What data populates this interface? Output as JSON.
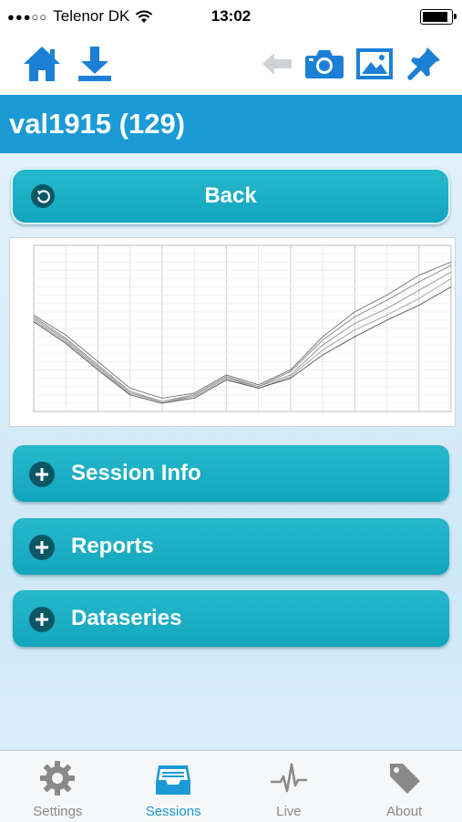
{
  "status_bar": {
    "carrier": "Telenor DK",
    "time": "13:02"
  },
  "toolbar": {
    "icons": [
      "home-icon",
      "download-icon",
      "back-arrow-icon",
      "camera-icon",
      "image-icon",
      "pin-icon"
    ]
  },
  "header": {
    "title": "val1915 (129)"
  },
  "back_button": {
    "label": "Back"
  },
  "sections": [
    {
      "label": "Session Info"
    },
    {
      "label": "Reports"
    },
    {
      "label": "Dataseries"
    }
  ],
  "colors": {
    "accent": "#1b9ad6",
    "pill": "#17aac0",
    "tab_active": "#1b9ad6",
    "tab_inactive": "#8a8a8a"
  },
  "tabs": [
    {
      "label": "Settings",
      "icon": "gear-icon",
      "active": false
    },
    {
      "label": "Sessions",
      "icon": "inbox-icon",
      "active": true
    },
    {
      "label": "Live",
      "icon": "pulse-icon",
      "active": false
    },
    {
      "label": "About",
      "icon": "tag-icon",
      "active": false
    }
  ],
  "chart_data": {
    "type": "line",
    "title": "",
    "xlabel": "",
    "ylabel": "",
    "x": [
      0,
      1,
      2,
      3,
      4,
      5,
      6,
      7,
      8,
      9,
      10,
      11,
      12,
      13
    ],
    "ylim": [
      0,
      100
    ],
    "grid": true,
    "series": [
      {
        "values": [
          58,
          46,
          30,
          14,
          8,
          11,
          22,
          16,
          25,
          45,
          60,
          70,
          82,
          90
        ]
      },
      {
        "values": [
          57,
          44,
          28,
          12,
          6,
          10,
          21,
          15,
          24,
          43,
          57,
          67,
          78,
          88
        ]
      },
      {
        "values": [
          56,
          43,
          27,
          11,
          6,
          9,
          20,
          15,
          22,
          40,
          53,
          62,
          73,
          84
        ]
      },
      {
        "values": [
          55,
          42,
          26,
          10,
          5,
          9,
          20,
          14,
          21,
          37,
          49,
          58,
          68,
          80
        ]
      },
      {
        "values": [
          54,
          41,
          25,
          10,
          5,
          8,
          19,
          14,
          20,
          34,
          45,
          55,
          64,
          75
        ]
      }
    ]
  }
}
